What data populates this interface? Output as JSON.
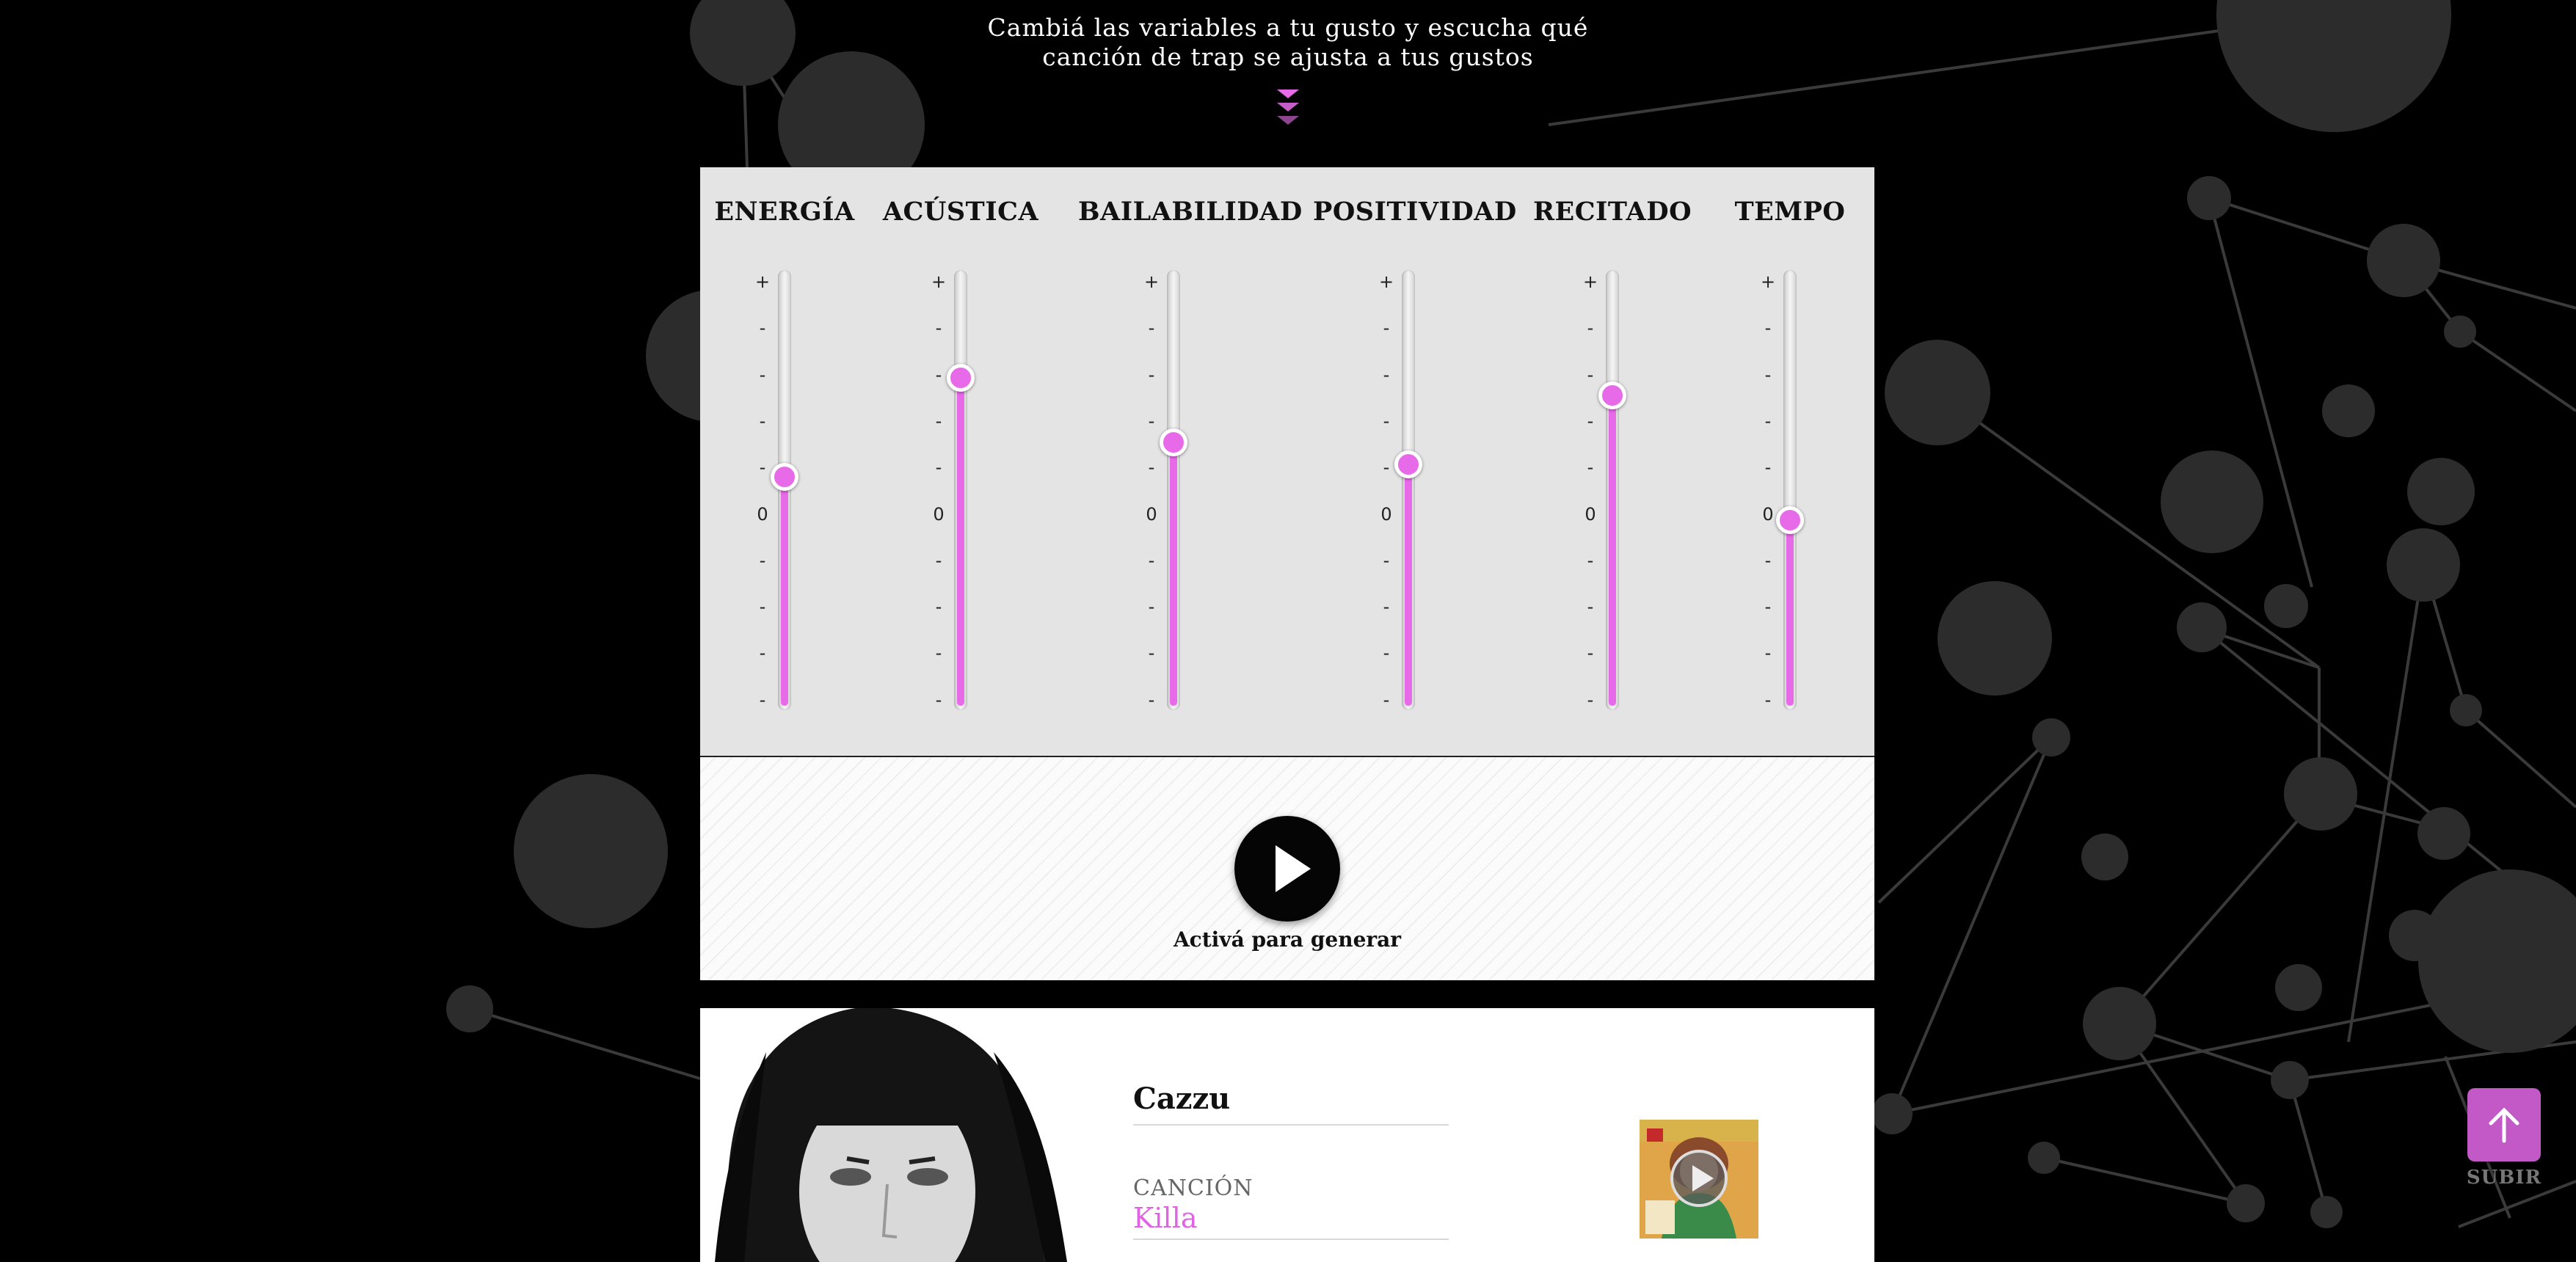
{
  "intro": {
    "line1": "Cambiá las variables a tu gusto y escucha qué",
    "line2": "canción de trap se ajusta a tus gustos"
  },
  "colors": {
    "accent": "#e76ae8",
    "panel": "#e4e4e4",
    "background": "#000000"
  },
  "sliders": [
    {
      "label": "ENERGÍA",
      "value": 0.53
    },
    {
      "label": "ACÚSTICA",
      "value": 0.76
    },
    {
      "label": "BAILABILIDAD",
      "value": 0.61
    },
    {
      "label": "POSITIVIDAD",
      "value": 0.56
    },
    {
      "label": "RECITADO",
      "value": 0.72
    },
    {
      "label": "TEMPO",
      "value": 0.43
    }
  ],
  "ticks": [
    "+",
    "-",
    "-",
    "-",
    "-",
    "0",
    "-",
    "-",
    "-",
    "-"
  ],
  "generator": {
    "label": "Activá para generar",
    "icon": "play-icon"
  },
  "result": {
    "artist": "Cazzu",
    "song_caption": "CANCIÓN",
    "song": "Killa",
    "cover_icon": "play-icon"
  },
  "scroll_top": {
    "label": "SUBIR",
    "icon": "arrow-up-icon"
  }
}
